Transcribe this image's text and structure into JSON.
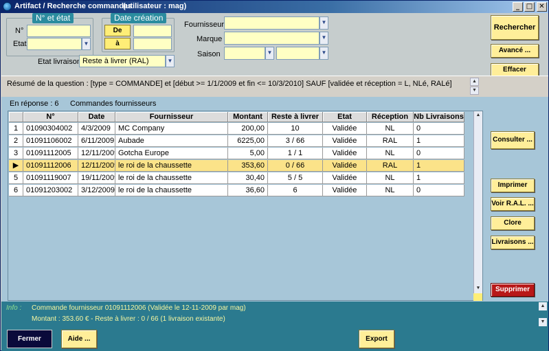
{
  "window": {
    "title": "Artifact / Recherche commandes",
    "user": "(utilisateur : mag)",
    "buttons": {
      "minimize": "_",
      "maximize": "□",
      "close": "✕"
    }
  },
  "search": {
    "group_num_etat": "N° et état",
    "label_num": "N°",
    "label_etat": "Etat",
    "num_value": "",
    "etat_value": "",
    "group_date": "Date création",
    "date_from_btn": "De",
    "date_to_btn": "à",
    "date_from_value": "",
    "date_to_value": "",
    "label_etat_livraison": "Etat livraison",
    "etat_livraison_value": "Reste à livrer (RAL)",
    "label_fournisseur": "Fournisseur",
    "label_marque": "Marque",
    "label_saison": "Saison",
    "fournisseur_value": "",
    "marque_value": "",
    "saison_value1": "",
    "saison_value2": "",
    "rechercher": "Rechercher",
    "avance": "Avancé ...",
    "effacer": "Effacer"
  },
  "summary": {
    "text": "Résumé de la question : [type = COMMANDE] et [début >= 1/1/2009 et fin <= 10/3/2010] SAUF [validée et réception = L, NLé, RALé]"
  },
  "results": {
    "count_label": "En réponse :  6",
    "title": "Commandes fournisseurs",
    "columns": [
      "",
      "N°",
      "Date",
      "Fournisseur",
      "Montant",
      "Reste à livrer",
      "Etat",
      "Réception",
      "Nb Livraisons"
    ],
    "rows": [
      {
        "idx": "1",
        "num": "01090304002",
        "date": "4/3/2009",
        "fournisseur": "MC Company",
        "montant": "200,00",
        "reste": "10",
        "etat": "Validée",
        "reception": "NL",
        "nb": "0"
      },
      {
        "idx": "2",
        "num": "01091106002",
        "date": "6/11/2009",
        "fournisseur": "Aubade",
        "montant": "6225,00",
        "reste": "3 / 66",
        "etat": "Validée",
        "reception": "RAL",
        "nb": "1"
      },
      {
        "idx": "3",
        "num": "01091112005",
        "date": "12/11/2009",
        "fournisseur": "Gotcha Europe",
        "montant": "5,00",
        "reste": "1 / 1",
        "etat": "Validée",
        "reception": "NL",
        "nb": "0"
      },
      {
        "idx": "▶",
        "num": "01091112006",
        "date": "12/11/2009",
        "fournisseur": "le roi de la chaussette",
        "montant": "353,60",
        "reste": "0 / 66",
        "etat": "Validée",
        "reception": "RAL",
        "nb": "1"
      },
      {
        "idx": "5",
        "num": "01091119007",
        "date": "19/11/2009",
        "fournisseur": "le roi de la chaussette",
        "montant": "30,40",
        "reste": "5 / 5",
        "etat": "Validée",
        "reception": "NL",
        "nb": "1"
      },
      {
        "idx": "6",
        "num": "01091203002",
        "date": "3/12/2009",
        "fournisseur": "le roi de la chaussette",
        "montant": "36,60",
        "reste": "6",
        "etat": "Validée",
        "reception": "NL",
        "nb": "0"
      }
    ],
    "selected_index": 3
  },
  "actions": {
    "consulter": "Consulter ...",
    "imprimer": "Imprimer",
    "voir_ral": "Voir R.A.L. ...",
    "clore": "Clore",
    "livraisons": "Livraisons ...",
    "supprimer": "Supprimer"
  },
  "info": {
    "label": "Info :",
    "line1": "Commande fournisseur 01091112006 (Validée le 12-11-2009 par mag)",
    "line2": "Montant : 353.60 € - Reste à livrer : 0 / 66 (1 livraison existante)"
  },
  "footer": {
    "fermer": "Fermer",
    "aide": "Aide ...",
    "export": "Export"
  },
  "icons": {
    "dropdown": "▼",
    "scroll_up": "▲",
    "scroll_down": "▼"
  },
  "colors": {
    "accent_teal": "#2b8c9f",
    "field_yellow": "#ffffc4",
    "button_yellow": "#ffee99",
    "selected_row": "#fbe389",
    "danger": "#b81818"
  }
}
